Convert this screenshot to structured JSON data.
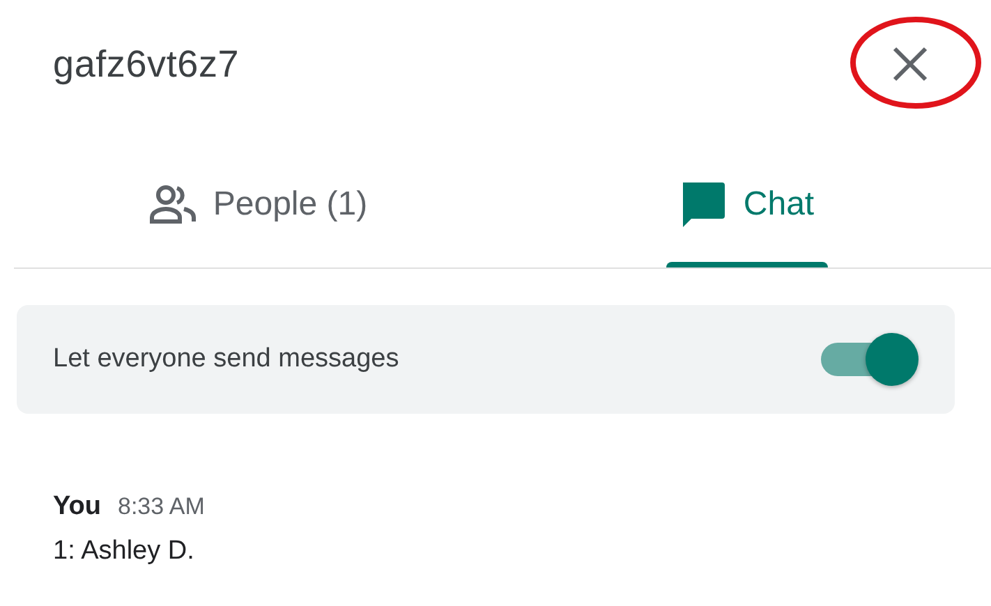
{
  "panel": {
    "title": "gafz6vt6z7"
  },
  "tabs": [
    {
      "kind": "people",
      "label": "People (1)",
      "selected": false
    },
    {
      "kind": "chat",
      "label": "Chat",
      "selected": true
    }
  ],
  "setting": {
    "label": "Let everyone send messages",
    "on": true
  },
  "messages": [
    {
      "sender": "You",
      "time": "8:33 AM",
      "text": "1: Ashley D."
    }
  ]
}
